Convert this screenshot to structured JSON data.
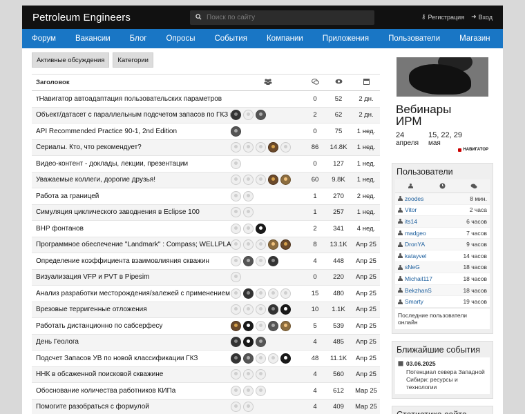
{
  "header": {
    "brand": "Petroleum Engineers",
    "search_placeholder": "Поиск по сайту",
    "register": "Регистрация",
    "login": "Вход"
  },
  "nav": [
    "Форум",
    "Вакансии",
    "Блог",
    "Опросы",
    "События",
    "Компании",
    "Приложения",
    "Пользователи",
    "Магазин"
  ],
  "tabs": [
    "Активные обсуждения",
    "Категории"
  ],
  "table": {
    "header_title": "Заголовок",
    "icons": [
      "users-icon",
      "comments-icon",
      "views-icon",
      "calendar-icon"
    ],
    "rows": [
      {
        "title": "тНавигатор автоадаптация пользовательских параметров",
        "avatars": [],
        "replies": "0",
        "views": "52",
        "date": "2 дн."
      },
      {
        "title": "Объект/датасет с параллельным подсчетом запасов по ГКЗ и PRMS",
        "avatars": [
          "d1",
          "p",
          "d2"
        ],
        "replies": "2",
        "views": "62",
        "date": "2 дн."
      },
      {
        "title": "API Recommended Practice 90-1, 2nd Edition",
        "avatars": [
          "d2"
        ],
        "replies": "0",
        "views": "75",
        "date": "1 нед."
      },
      {
        "title": "Сериалы. Кто, что рекомендует?",
        "avatars": [
          "p",
          "p",
          "p",
          "d3",
          "p"
        ],
        "replies": "86",
        "views": "14.8K",
        "date": "1 нед."
      },
      {
        "title": "Видео-контент - доклады, лекции, презентации",
        "avatars": [
          "p"
        ],
        "replies": "0",
        "views": "127",
        "date": "1 нед."
      },
      {
        "title": "Уважаемые коллеги, дорогие друзья!",
        "avatars": [
          "p",
          "p",
          "p",
          "d3",
          "d5"
        ],
        "replies": "60",
        "views": "9.8K",
        "date": "1 нед."
      },
      {
        "title": "Работа за границей",
        "avatars": [
          "p",
          "p"
        ],
        "replies": "1",
        "views": "270",
        "date": "2 нед."
      },
      {
        "title": "Симуляция циклического заводнения в Eclipse 100",
        "avatars": [
          "p",
          "p"
        ],
        "replies": "1",
        "views": "257",
        "date": "1 нед."
      },
      {
        "title": "BHP фонтанов",
        "avatars": [
          "p",
          "p",
          "d4"
        ],
        "replies": "2",
        "views": "341",
        "date": "4 нед."
      },
      {
        "title": "Программное обеспечение \"Landmark\" : Compass; WELLPLAN",
        "avatars": [
          "p",
          "p",
          "p",
          "d5",
          "d3"
        ],
        "replies": "8",
        "views": "13.1K",
        "date": "Апр 25"
      },
      {
        "title": "Определение коэффициента взаимовлияния скважин",
        "avatars": [
          "p",
          "d2",
          "p",
          "d1"
        ],
        "replies": "4",
        "views": "448",
        "date": "Апр 25"
      },
      {
        "title": "Визуализация VFP и PVT в Pipesim",
        "avatars": [
          "p"
        ],
        "replies": "0",
        "views": "220",
        "date": "Апр 25"
      },
      {
        "title": "Анализ разработки месторождения/залежей с применением ХВ",
        "avatars": [
          "p",
          "d1",
          "p",
          "p",
          "p"
        ],
        "replies": "15",
        "views": "480",
        "date": "Апр 25"
      },
      {
        "title": "Врезовые терригенные отложения",
        "avatars": [
          "p",
          "p",
          "p",
          "d1",
          "d4"
        ],
        "replies": "10",
        "views": "1.1K",
        "date": "Апр 25"
      },
      {
        "title": "Работать дистанционно по сабсерфесу",
        "avatars": [
          "d3",
          "d4",
          "p",
          "d2",
          "d5"
        ],
        "replies": "5",
        "views": "539",
        "date": "Апр 25"
      },
      {
        "title": "День Геолога",
        "avatars": [
          "d1",
          "d4",
          "d2"
        ],
        "replies": "4",
        "views": "485",
        "date": "Апр 25"
      },
      {
        "title": "Подсчет Запасов УВ по новой классификации ГКЗ",
        "avatars": [
          "d1",
          "d2",
          "p",
          "p",
          "d4"
        ],
        "replies": "48",
        "views": "11.1K",
        "date": "Апр 25"
      },
      {
        "title": "ННК в обсаженной поисковой скважине",
        "avatars": [
          "p",
          "p",
          "p"
        ],
        "replies": "4",
        "views": "560",
        "date": "Апр 25"
      },
      {
        "title": "Обоснование количества работников КИПа",
        "avatars": [
          "p",
          "p",
          "p"
        ],
        "replies": "4",
        "views": "612",
        "date": "Мар 25"
      },
      {
        "title": "Помогите разобраться с формулой",
        "avatars": [
          "p",
          "p"
        ],
        "replies": "4",
        "views": "409",
        "date": "Мар 25"
      }
    ]
  },
  "ad": {
    "title_line1": "Вебинары",
    "title_line2": "ИРМ",
    "date1_day": "24",
    "date1_month": "апреля",
    "date2_day": "15, 22, 29",
    "date2_month": "мая",
    "logo": "НАВИГАТОР"
  },
  "users_panel": {
    "title": "Пользователи",
    "icons": [
      "person-icon",
      "clock-icon",
      "comments-icon"
    ],
    "users": [
      {
        "name": "zoodes",
        "time": "8 мин."
      },
      {
        "name": "Vitor",
        "time": "2 часа"
      },
      {
        "name": "its14",
        "time": "6 часов"
      },
      {
        "name": "madgeo",
        "time": "7 часов"
      },
      {
        "name": "DronYA",
        "time": "9 часов"
      },
      {
        "name": "katayvel",
        "time": "14 часов"
      },
      {
        "name": "sNeG",
        "time": "18 часов"
      },
      {
        "name": "Michail117",
        "time": "18 часов"
      },
      {
        "name": "BekzhanS",
        "time": "18 часов"
      },
      {
        "name": "Smarty",
        "time": "19 часов"
      }
    ],
    "footer": "Последние пользователи онлайн"
  },
  "events_panel": {
    "title": "Ближайшие события",
    "date": "03.06.2025",
    "description": "Потенциал севера Западной Сибири: ресурсы и технологии"
  },
  "stats_panel": {
    "title": "Статистика сайта"
  }
}
